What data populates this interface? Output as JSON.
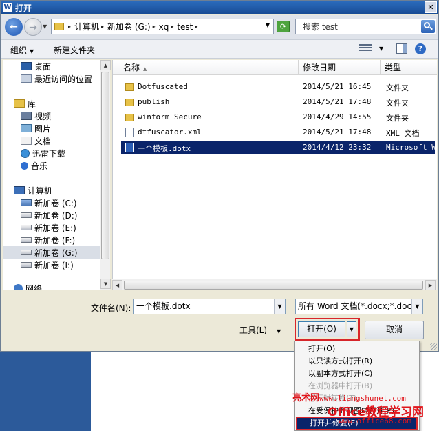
{
  "window": {
    "title": "打开",
    "app_icon": "W",
    "close_label": "✕"
  },
  "address": {
    "crumbs": [
      "计算机",
      "新加卷 (G:)",
      "xq",
      "test"
    ],
    "search_placeholder": "搜索 test"
  },
  "toolbar": {
    "organize": "组织",
    "new_folder": "新建文件夹"
  },
  "nav": {
    "items": [
      {
        "label": "桌面",
        "icon": "desktop-icon"
      },
      {
        "label": "最近访问的位置",
        "icon": "recent-places-icon"
      },
      {
        "label": "库",
        "icon": "library-icon"
      },
      {
        "label": "视频",
        "icon": "video-icon"
      },
      {
        "label": "图片",
        "icon": "picture-icon"
      },
      {
        "label": "文档",
        "icon": "document-icon"
      },
      {
        "label": "迅雷下载",
        "icon": "thunder-icon"
      },
      {
        "label": "音乐",
        "icon": "music-icon"
      },
      {
        "label": "计算机",
        "icon": "computer-icon"
      },
      {
        "label": "新加卷 (C:)",
        "icon": "drive-icon"
      },
      {
        "label": "新加卷 (D:)",
        "icon": "drive-icon"
      },
      {
        "label": "新加卷 (E:)",
        "icon": "drive-icon"
      },
      {
        "label": "新加卷 (F:)",
        "icon": "drive-icon"
      },
      {
        "label": "新加卷 (G:)",
        "icon": "drive-icon",
        "selected": true
      },
      {
        "label": "新加卷 (I:)",
        "icon": "drive-icon"
      },
      {
        "label": "网络",
        "icon": "network-icon"
      }
    ]
  },
  "list": {
    "columns": {
      "name": "名称",
      "modified": "修改日期",
      "type": "类型"
    },
    "rows": [
      {
        "name": "Dotfuscated",
        "modified": "2014/5/21 16:45",
        "type": "文件夹",
        "icon": "folder-icon"
      },
      {
        "name": "publish",
        "modified": "2014/5/21 17:48",
        "type": "文件夹",
        "icon": "folder-icon"
      },
      {
        "name": "winform_Secure",
        "modified": "2014/4/29 14:55",
        "type": "文件夹",
        "icon": "folder-icon"
      },
      {
        "name": "dtfuscator.xml",
        "modified": "2014/5/21 17:48",
        "type": "XML 文档",
        "icon": "xml-file-icon"
      },
      {
        "name": "一个模板.dotx",
        "modified": "2014/4/12 23:32",
        "type": "Microsoft Wor",
        "icon": "word-file-icon",
        "selected": true
      }
    ]
  },
  "form": {
    "filename_label": "文件名(N):",
    "filename_value": "一个模板.dotx",
    "filetype_value": "所有 Word 文档(*.docx;*.docm",
    "tools_label": "工具(L)",
    "open_label": "打开(O)",
    "cancel_label": "取消"
  },
  "open_menu": [
    {
      "label": "打开(O)",
      "state": "normal"
    },
    {
      "label": "以只读方式打开(R)",
      "state": "normal"
    },
    {
      "label": "以副本方式打开(C)",
      "state": "normal"
    },
    {
      "label": "在浏览器中打开(B)",
      "state": "disabled"
    },
    {
      "label": "打开时转换(T)",
      "state": "disabled"
    },
    {
      "label": "在受保护的视图中打开(P)",
      "state": "normal"
    },
    {
      "label": "打开并修复(E)",
      "state": "highlight"
    }
  ],
  "watermark": {
    "line1_a": "亮术网",
    "line1_b": "www.liangshunet.com",
    "line2": "Office教程学习网",
    "line3": "www.office68.com"
  },
  "colors": {
    "selection": "#0a246a",
    "highlight_border": "#d9262b",
    "watermark": "#e0161c"
  }
}
